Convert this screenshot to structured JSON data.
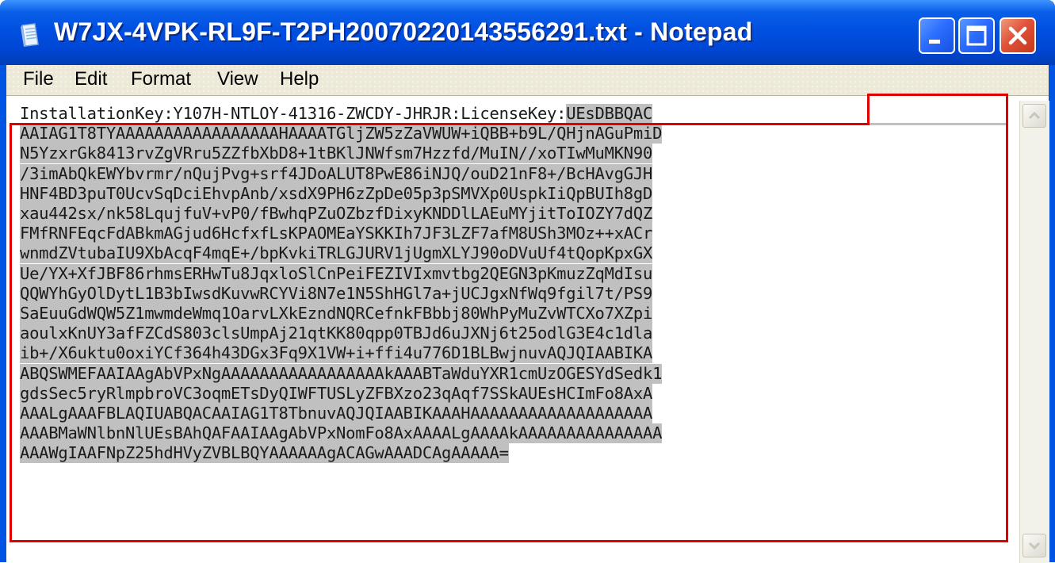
{
  "window": {
    "title": "W7JX-4VPK-RL9F-T2PH20070220143556291.txt - Notepad",
    "icon": "notepad-icon"
  },
  "controls": {
    "minimize_icon": "minimize-icon",
    "maximize_icon": "maximize-icon",
    "close_icon": "close-icon"
  },
  "menu": {
    "file": "File",
    "edit": "Edit",
    "format": "Format",
    "view": "View",
    "help": "Help"
  },
  "content": {
    "first_line_prefix": "InstallationKey:Y107H-NTLOY-41316-ZWCDY-JHRJR:LicenseKey:",
    "first_line_selected": "UEsDBBQAC",
    "lines": [
      "AAIAG1T8TYAAAAAAAAAAAAAAAAAHAAAATGljZW5zZaVWUW+iQBB+b9L/QHjnAGuPmiD",
      "N5YzxrGk8413rvZgVRru5ZZfbXbD8+1tBKlJNWfsm7Hzzfd/MuIN//xoTIwMuMKN90",
      "/3imAbQkEWYbvrmr/nQujPvg+srf4JDoALUT8PwE86iNJQ/ouD21nF8+/BcHAvgGJH",
      "HNF4BD3puT0UcvSqDciEhvpAnb/xsdX9PH6zZpDe05p3pSMVXp0UspkIiQpBUIh8gD",
      "xau442sx/nk58LqujfuV+vP0/fBwhqPZuOZbzfDixyKNDDlLAEuMYjitToIOZY7dQZ",
      "FMfRNFEqcFdABkmAGjud6HcfxfLsKPAOMEaYSKKIh7JF3LZF7afM8USh3MOz++xACr",
      "wnmdZVtubaIU9XbAcqF4mqE+/bpKvkiTRLGJURV1jUgmXLYJ90oDVuUf4tQopKpxGX",
      "Ue/YX+XfJBF86rhmsERHwTu8JqxloSlCnPeiFEZIVIxmvtbg2QEGN3pKmuzZqMdIsu",
      "QQWYhGyOlDytL1B3bIwsdKuvwRCYVi8N7e1N5ShHGl7a+jUCJgxNfWq9fgil7t/PS9",
      "SaEuuGdWQW5Z1mwmdeWmq1OarvLXkEzndNQRCefnkFBbbj80WhPyMuZvWTCXo7XZpi",
      "aoulxKnUY3afFZCdS803clsUmpAj21qtKK80qpp0TBJd6uJXNj6t25odlG3E4c1dla",
      "ib+/X6uktu0oxiYCf364h43DGx3Fq9X1VW+i+ffi4u776D1BLBwjnuvAQJQIAABIKA",
      "ABQSWMEFAAIAAgAbVPxNgAAAAAAAAAAAAAAAAAkAAABTaWduYXR1cmUzOGESYdSedk1",
      "gdsSec5ryRlmpbroVC3oqmETsDyQIWFTUSLyZFBXzo23qAqf7SSkAUEsHCImFo8AxA",
      "AAALgAAAFBLAQIUABQACAAIAG1T8TbnuvAQJQIAABIKAAAHAAAAAAAAAAAAAAAAAAA",
      "AAABMaWNlbnNlUEsBAhQAFAAIAAgAbVPxNomFo8AxAAAALgAAAAkAAAAAAAAAAAAAAA",
      "AAAWgIAAFNpZ25hdHVyZVBLBQYAAAAAAgACAGwAAADCAgAAAAA="
    ]
  }
}
